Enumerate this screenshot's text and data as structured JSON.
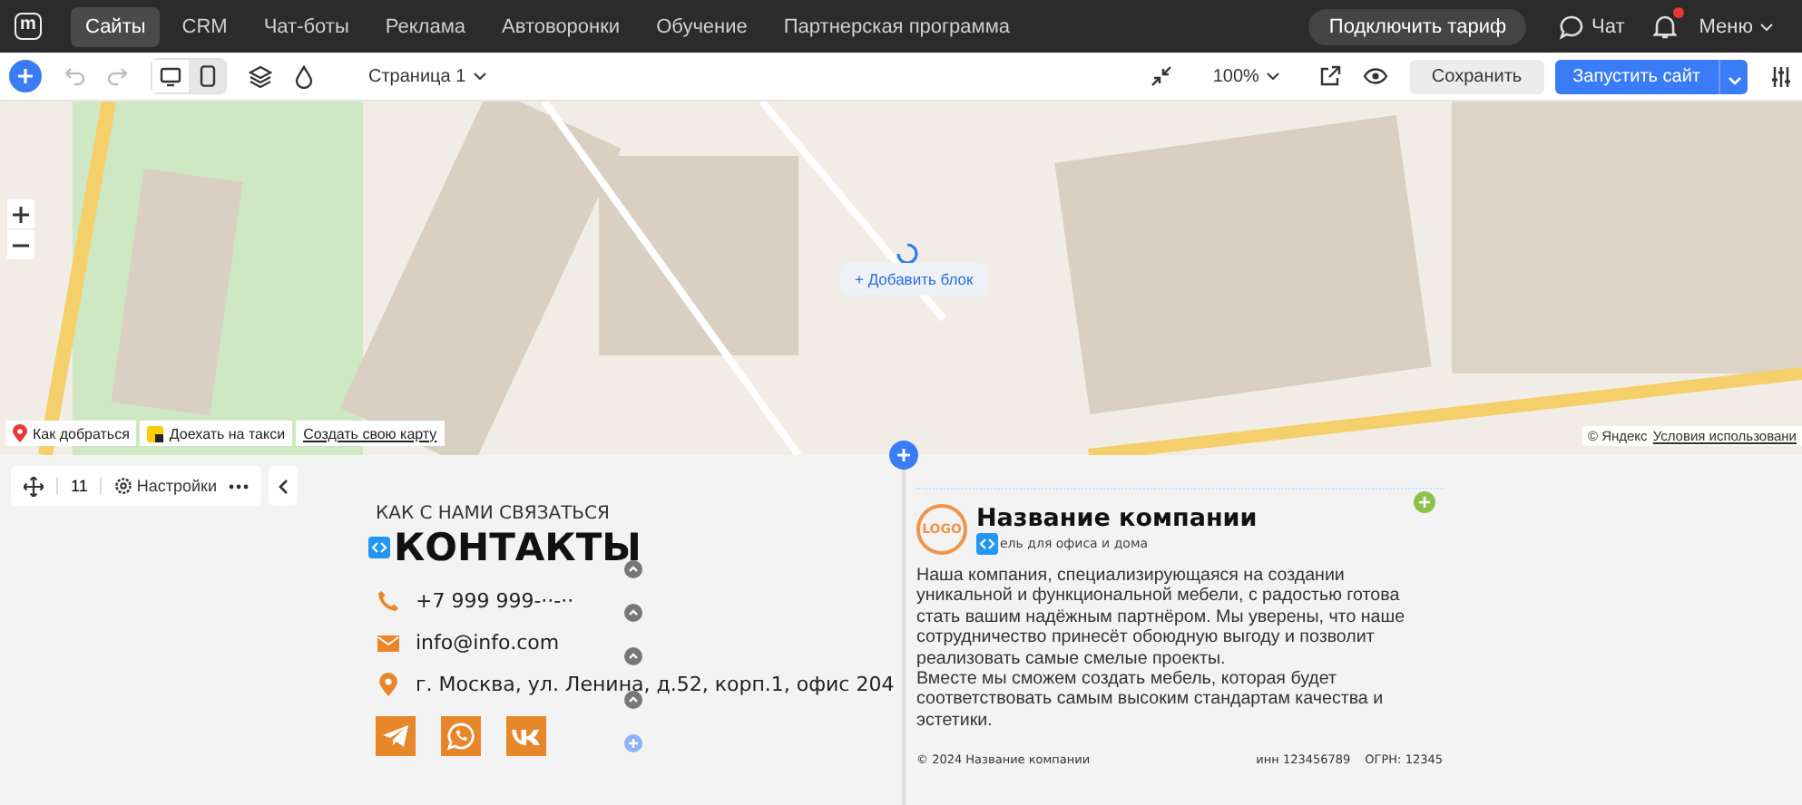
{
  "nav": {
    "logo": "m",
    "items": [
      {
        "label": "Сайты",
        "selected": true
      },
      {
        "label": "CRM",
        "selected": false
      },
      {
        "label": "Чат-боты",
        "selected": false
      },
      {
        "label": "Реклама",
        "selected": false
      },
      {
        "label": "Автоворонки",
        "selected": false
      },
      {
        "label": "Обучение",
        "selected": false
      },
      {
        "label": "Партнерская программа",
        "selected": false
      }
    ],
    "upgrade": "Подключить тариф",
    "chat": "Чат",
    "unread": true,
    "menu": "Меню"
  },
  "toolbar": {
    "devices": [
      {
        "kind": "desktop",
        "selected": false
      },
      {
        "kind": "mobile",
        "selected": true
      }
    ],
    "page": "Страница 1",
    "zoom": "100%",
    "save": "Сохранить",
    "publish": "Запустить сайт"
  },
  "map": {
    "add_block": "+ Добавить блок",
    "route": "Как добраться",
    "taxi": "Доехать на такси",
    "create": "Создать свою карту",
    "copyright": "© Яндекс",
    "terms": "Условия использовани"
  },
  "block_toolbar": {
    "number": "11",
    "settings": "Настройки"
  },
  "contacts": {
    "eyebrow": "КАК С НАМИ СВЯЗАТЬСЯ",
    "title": "КОНТАКТЫ",
    "items": [
      {
        "kind": "phone",
        "text": "+7 999 999-··-··"
      },
      {
        "kind": "email",
        "text": "info@info.com"
      },
      {
        "kind": "address",
        "text": "г. Москва, ул. Ленина, д.52, корп.1, офис 204"
      }
    ],
    "socials": [
      {
        "kind": "telegram"
      },
      {
        "kind": "whatsapp"
      },
      {
        "kind": "vk"
      }
    ]
  },
  "company": {
    "logo": "LOGO",
    "name": "Название компании",
    "tagline": "ель для офиса и дома",
    "paragraphs": [
      "Наша компания, специализирующаяся на создании уникальной и функциональной мебели, с радостью готова стать вашим надёжным партнёром. Мы уверены, что наше сотрудничество принесёт обоюдную выгоду и позволит реализовать самые смелые проекты.",
      "Вместе мы сможем создать мебель, которая будет соответствовать самым высоким стандартам качества и эстетики."
    ],
    "copyright": "© 2024 Название компании",
    "inn": "инн 123456789",
    "ogrn": "ОГРН: 12345"
  }
}
